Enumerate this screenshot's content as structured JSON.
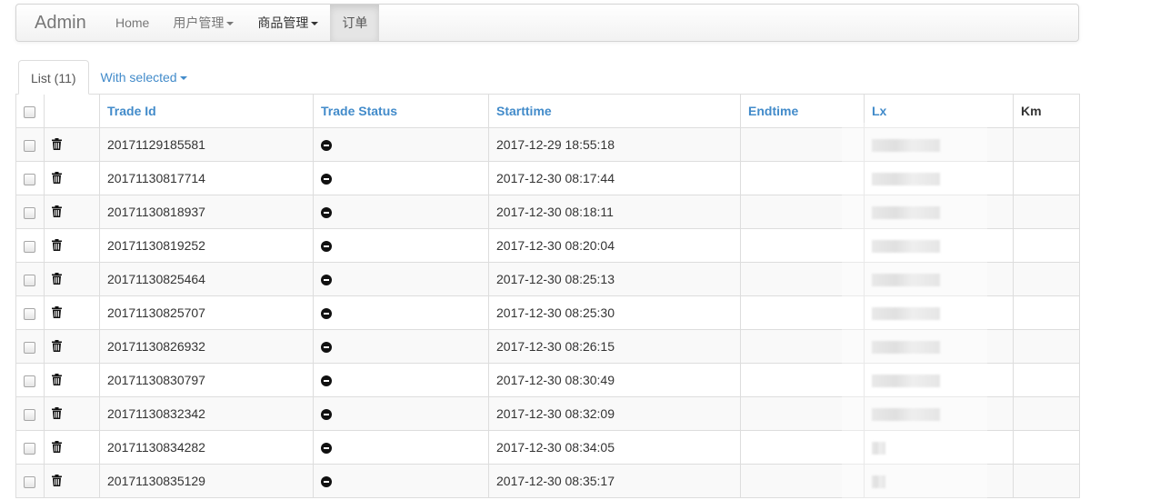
{
  "navbar": {
    "brand": "Admin",
    "items": [
      {
        "label": "Home"
      },
      {
        "label": "用户管理"
      },
      {
        "label": "商品管理"
      },
      {
        "label": "订单"
      }
    ]
  },
  "tabs": {
    "list_label": "List (11)",
    "with_selected_label": "With selected"
  },
  "table": {
    "columns": {
      "trade_id": "Trade Id",
      "trade_status": "Trade Status",
      "starttime": "Starttime",
      "endtime": "Endtime",
      "lx": "Lx",
      "km": "Km"
    },
    "rows": [
      {
        "trade_id": "20171129185581",
        "starttime": "2017-12-29 18:55:18",
        "endtime": "",
        "km": ""
      },
      {
        "trade_id": "20171130817714",
        "starttime": "2017-12-30 08:17:44",
        "endtime": "",
        "km": ""
      },
      {
        "trade_id": "20171130818937",
        "starttime": "2017-12-30 08:18:11",
        "endtime": "",
        "km": ""
      },
      {
        "trade_id": "20171130819252",
        "starttime": "2017-12-30 08:20:04",
        "endtime": "",
        "km": ""
      },
      {
        "trade_id": "20171130825464",
        "starttime": "2017-12-30 08:25:13",
        "endtime": "",
        "km": ""
      },
      {
        "trade_id": "20171130825707",
        "starttime": "2017-12-30 08:25:30",
        "endtime": "",
        "km": ""
      },
      {
        "trade_id": "20171130826932",
        "starttime": "2017-12-30 08:26:15",
        "endtime": "",
        "km": ""
      },
      {
        "trade_id": "20171130830797",
        "starttime": "2017-12-30 08:30:49",
        "endtime": "",
        "km": ""
      },
      {
        "trade_id": "20171130832342",
        "starttime": "2017-12-30 08:32:09",
        "endtime": "",
        "km": ""
      },
      {
        "trade_id": "20171130834282",
        "starttime": "2017-12-30 08:34:05",
        "endtime": "",
        "km": ""
      },
      {
        "trade_id": "20171130835129",
        "starttime": "2017-12-30 08:35:17",
        "endtime": "",
        "km": ""
      }
    ],
    "row_icons": {
      "delete": "trash-icon",
      "status": "minus-circle-icon"
    }
  },
  "colors": {
    "link": "#428bca",
    "striped_row": "#f9f9f9",
    "border": "#dddddd"
  }
}
